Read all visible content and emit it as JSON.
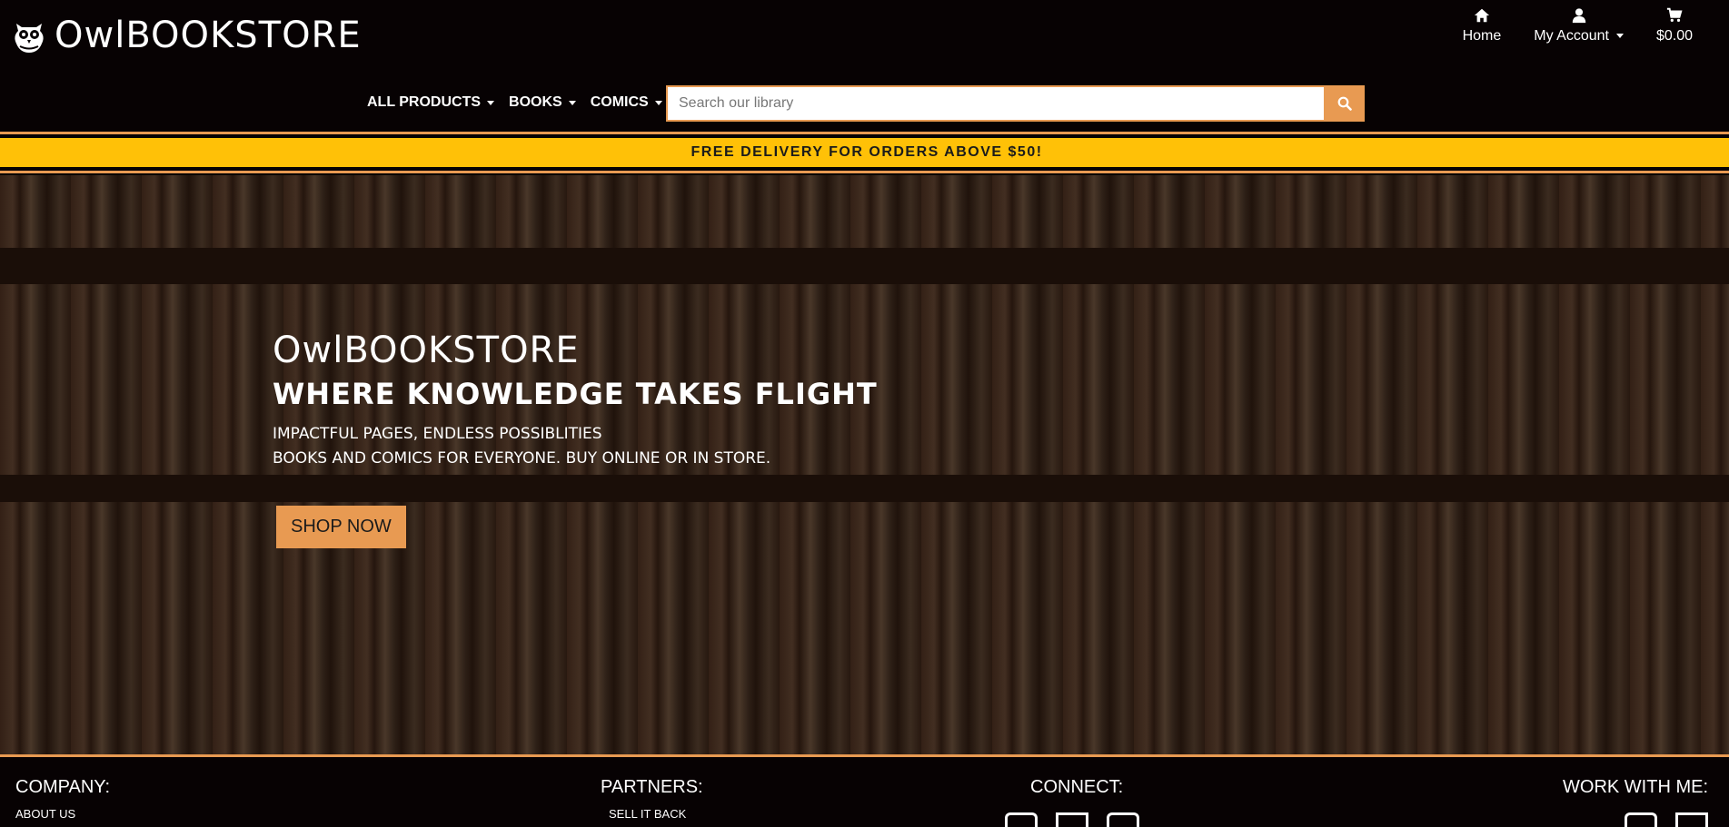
{
  "brand": {
    "name": "OwlBOOKSTORE"
  },
  "util_nav": {
    "home": "Home",
    "account": "My Account",
    "cart": "$0.00"
  },
  "main_nav": [
    {
      "label": "ALL PRODUCTS"
    },
    {
      "label": "BOOKS"
    },
    {
      "label": "COMICS"
    }
  ],
  "search": {
    "placeholder": "Search our library"
  },
  "promo": {
    "text": "FREE DELIVERY FOR ORDERS ABOVE $50!"
  },
  "hero": {
    "title": "OwlBOOKSTORE",
    "subtitle": "WHERE KNOWLEDGE TAKES FLIGHT",
    "line1": "IMPACTFUL PAGES, ENDLESS POSSIBLITIES",
    "line2": "BOOKS AND COMICS FOR EVERYONE. BUY ONLINE OR IN STORE.",
    "cta": "SHOP NOW"
  },
  "footer": {
    "company": {
      "heading": "COMPANY:",
      "link": "ABOUT US"
    },
    "partners": {
      "heading": "PARTNERS:",
      "link": "SELL IT BACK"
    },
    "connect": {
      "heading": "CONNECT:"
    },
    "work": {
      "heading": "WORK WITH ME:"
    }
  },
  "colors": {
    "accent": "#e89a52",
    "promo": "#ffc107",
    "background": "#070203"
  }
}
